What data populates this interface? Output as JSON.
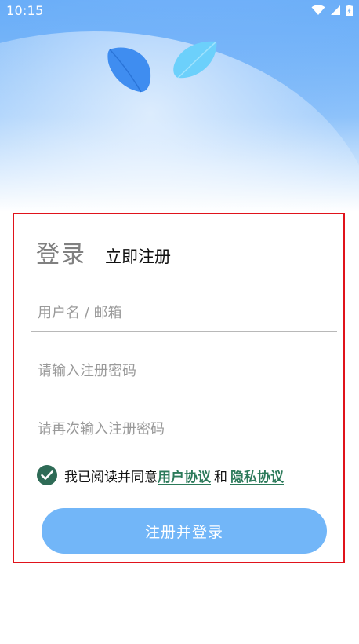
{
  "status_bar": {
    "time": "10:15",
    "icons": [
      "wifi-icon",
      "signal-icon",
      "battery-icon"
    ]
  },
  "tabs": {
    "login_label": "登录",
    "register_label": "立即注册"
  },
  "form": {
    "username_placeholder": "用户名 / 邮箱",
    "password_placeholder": "请输入注册密码",
    "confirm_placeholder": "请再次输入注册密码"
  },
  "agreement": {
    "checked": true,
    "prefix": "我已阅读并同意",
    "user_agreement": " 用户协议 ",
    "and": "和",
    "privacy_policy": " 隐私协议"
  },
  "submit": {
    "label": "注册并登录"
  },
  "colors": {
    "accent": "#72b6f8",
    "link": "#2c7a5a",
    "check": "#2e6b56",
    "card_border": "#e0131b"
  }
}
